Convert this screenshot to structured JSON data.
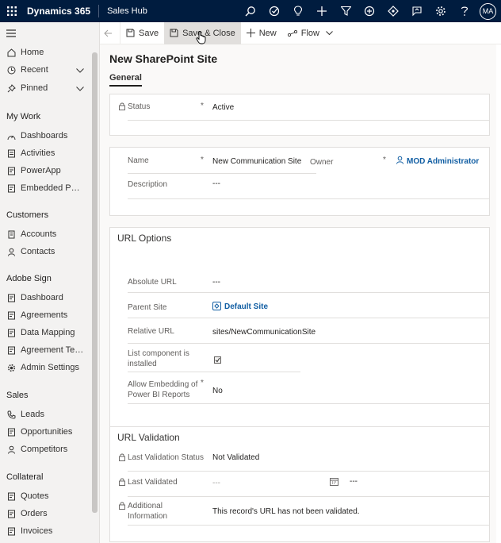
{
  "topbar": {
    "brand": "Dynamics 365",
    "app": "Sales Hub",
    "avatar": "MA",
    "icons": [
      "search-icon",
      "task-icon",
      "lightbulb-icon",
      "add-icon",
      "filter-icon",
      "plus-circle-icon",
      "diamond-icon",
      "assistant-icon",
      "settings-icon",
      "help-icon"
    ]
  },
  "sidebar": {
    "top_items": [
      {
        "label": "Home",
        "icon": "home-icon"
      },
      {
        "label": "Recent",
        "icon": "clock-icon"
      },
      {
        "label": "Pinned",
        "icon": "pin-icon"
      }
    ],
    "sections": [
      {
        "title": "My Work",
        "items": [
          "Dashboards",
          "Activities",
          "PowerApp",
          "Embedded Power..."
        ]
      },
      {
        "title": "Customers",
        "items": [
          "Accounts",
          "Contacts"
        ]
      },
      {
        "title": "Adobe Sign",
        "items": [
          "Dashboard",
          "Agreements",
          "Data Mapping",
          "Agreement Templ...",
          "Admin Settings"
        ]
      },
      {
        "title": "Sales",
        "items": [
          "Leads",
          "Opportunities",
          "Competitors"
        ]
      },
      {
        "title": "Collateral",
        "items": [
          "Quotes",
          "Orders",
          "Invoices"
        ]
      }
    ]
  },
  "cmdbar": {
    "save": "Save",
    "save_close": "Save & Close",
    "new": "New",
    "flow": "Flow"
  },
  "form": {
    "title": "New SharePoint Site",
    "tab": "General",
    "status_label": "Status",
    "status_value": "Active",
    "name_label": "Name",
    "name_value": "New Communication Site",
    "owner_label": "Owner",
    "owner_value": "MOD Administrator",
    "description_label": "Description",
    "description_value": "---",
    "url_options_title": "URL Options",
    "absolute_url_label": "Absolute URL",
    "absolute_url_value": "---",
    "parent_site_label": "Parent Site",
    "parent_site_value": "Default Site",
    "relative_url_label": "Relative URL",
    "relative_url_value": "sites/NewCommunicationSite",
    "list_component_label_1": "List component is",
    "list_component_label_2": "installed",
    "allow_embedding_label_1": "Allow Embedding of",
    "allow_embedding_label_2": "Power BI Reports",
    "allow_embedding_value": "No",
    "url_validation_title": "URL Validation",
    "last_validation_status_label": "Last Validation Status",
    "last_validation_status_value": "Not Validated",
    "last_validated_label": "Last Validated",
    "last_validated_value": "---",
    "last_validated_time": "---",
    "additional_info_label_1": "Additional",
    "additional_info_label_2": "Information",
    "additional_info_value": "This record's URL has not been validated.",
    "required_mark": "*"
  }
}
